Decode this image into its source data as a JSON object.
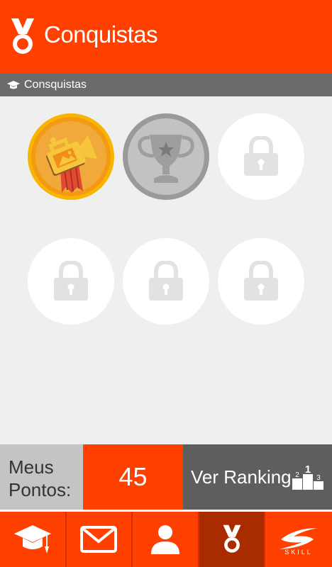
{
  "header": {
    "title": "Conquistas",
    "icon": "medal-icon"
  },
  "section": {
    "label": "Consquistas",
    "icon": "graduation-cap-icon"
  },
  "badges": [
    {
      "name": "video-camera-badge",
      "state": "unlocked"
    },
    {
      "name": "trophy-badge",
      "state": "unlocked"
    },
    {
      "name": "locked-badge",
      "state": "locked"
    },
    {
      "name": "locked-badge",
      "state": "locked"
    },
    {
      "name": "locked-badge",
      "state": "locked"
    },
    {
      "name": "locked-badge",
      "state": "locked"
    }
  ],
  "stats": {
    "my_points_label": "Meus Pontos:",
    "points": "45",
    "ranking_label": "Ver Ranking"
  },
  "podium": {
    "first": "1",
    "second": "2",
    "third": "3"
  },
  "nav": {
    "skill_label": "SKILL"
  },
  "colors": {
    "accent": "#ff4000",
    "active_nav": "#a92b00",
    "gray_bar": "#6b6b6b"
  }
}
